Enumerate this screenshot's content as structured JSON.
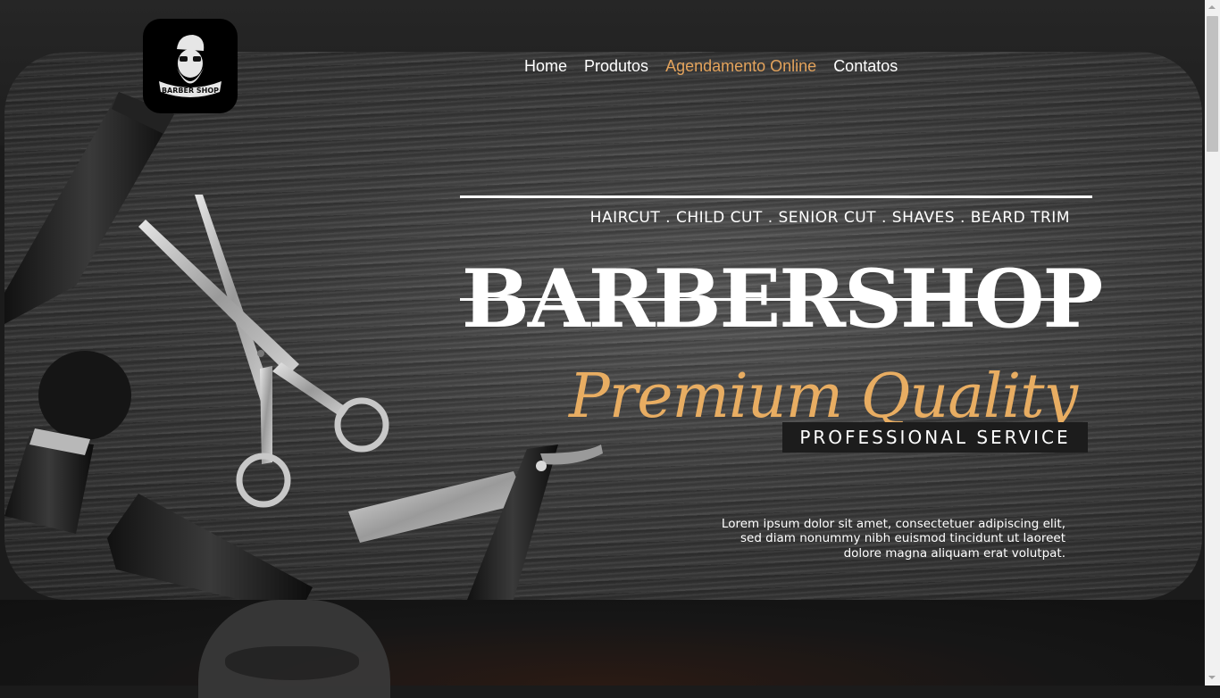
{
  "logo": {
    "text": "BARBER SHOP"
  },
  "nav": {
    "items": [
      {
        "label": "Home"
      },
      {
        "label": "Produtos"
      },
      {
        "label": "Agendamento Online",
        "active": true
      },
      {
        "label": "Contatos"
      }
    ]
  },
  "hero": {
    "services": "HAIRCUT . CHILD CUT . SENIOR CUT . SHAVES . BEARD TRIM",
    "title": "BARBERSHOP",
    "tagline": "Premium Quality",
    "badge": "PROFESSIONAL SERVICE",
    "description": "Lorem ipsum dolor sit amet, consectetuer adipiscing elit, sed diam nonummy nibh euismod tincidunt ut laoreet dolore magna aliquam erat volutpat."
  },
  "colors": {
    "accent": "#e3a35c",
    "background": "#1b1b1b",
    "text": "#ffffff"
  }
}
